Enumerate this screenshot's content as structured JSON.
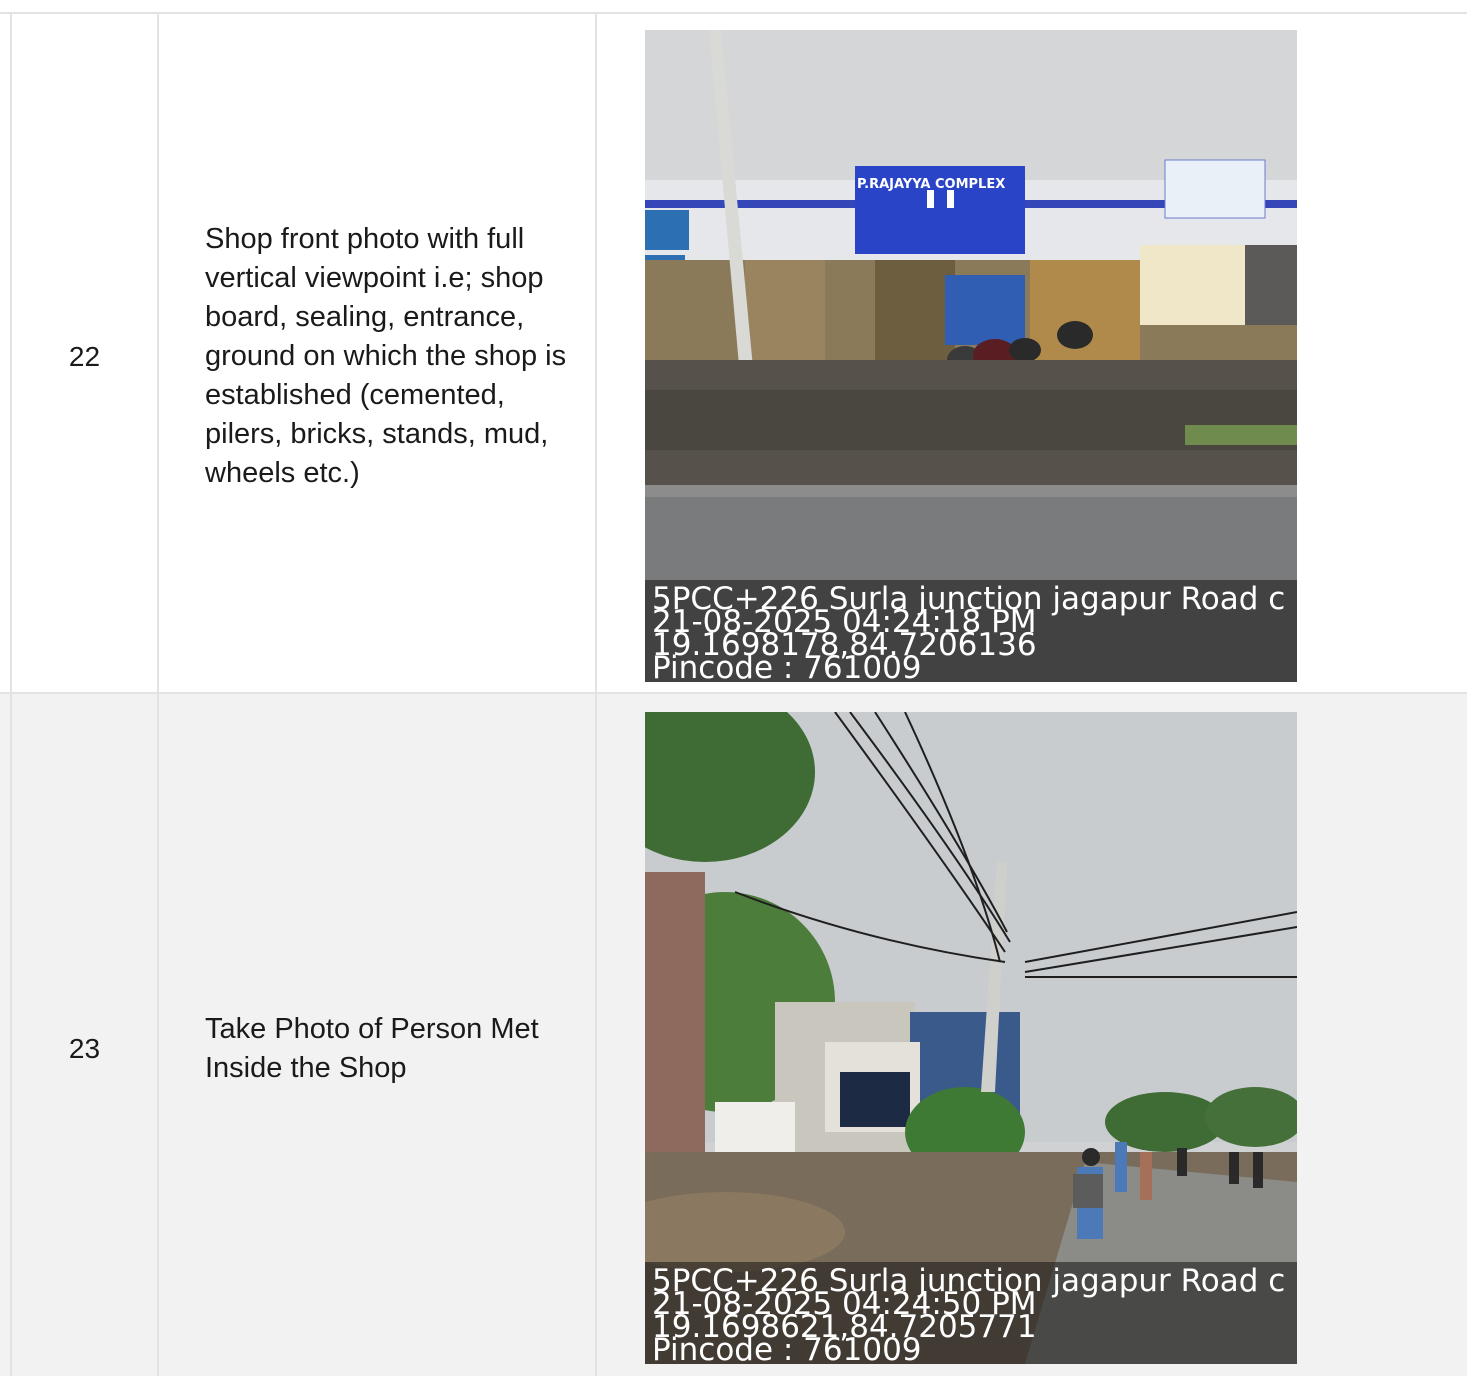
{
  "rows": [
    {
      "number": "22",
      "description": "Shop front photo with full vertical viewpoint i.e; shop board, sealing, entrance, ground on which the shop is established (cemented, pilers, bricks, stands, mud, wheels etc.)",
      "photo": {
        "sign_text": "P.RAJAYYA COMPLEX",
        "stamp": {
          "address": "5PCC+226 Surla junction jagapur Road c",
          "datetime": "21-08-2025 04:24:18 PM",
          "coords": "19.1698178,84.7206136",
          "pincode": "Pincode : 761009"
        }
      }
    },
    {
      "number": "23",
      "description": "Take Photo of Person Met Inside the Shop",
      "photo": {
        "stamp": {
          "address": "5PCC+226 Surla junction jagapur Road c",
          "datetime": "21-08-2025 04:24:50 PM",
          "coords": "19.1698621,84.7205771",
          "pincode": "Pincode : 761009"
        }
      }
    }
  ],
  "colors": {
    "row_alt_bg": "#f2f2f2",
    "border": "#e3e3e3",
    "shop_blue": "#2a44c8"
  }
}
